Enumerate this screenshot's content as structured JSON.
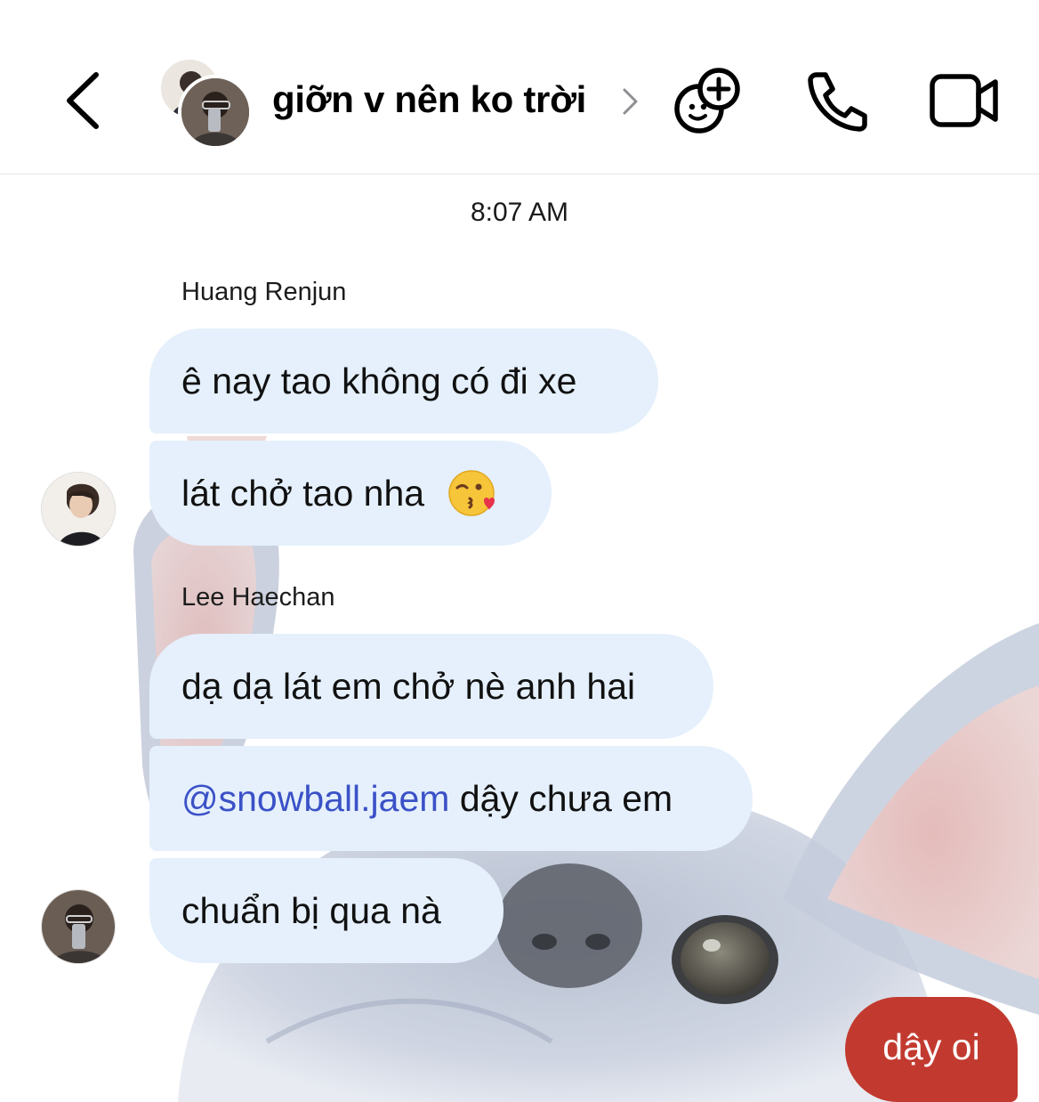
{
  "header": {
    "title": "giỡn v nên ko trời"
  },
  "timestamp": "8:07 AM",
  "messages": [
    {
      "sender": "Huang Renjun",
      "bubbles": [
        {
          "text": "ê nay tao không có đi xe"
        },
        {
          "text": "lát chở tao nha"
        }
      ]
    },
    {
      "sender": "Lee Haechan",
      "bubbles": [
        {
          "text": "dạ dạ lát em chở nè anh hai"
        },
        {
          "mention": "@snowball.jaem",
          "text": " dậy chưa em"
        },
        {
          "text": "chuẩn bị qua nà"
        }
      ]
    }
  ],
  "outgoing": {
    "text": "dậy oi",
    "color": "#c23a2f"
  },
  "colors": {
    "incoming_bubble": "#e5f0fc",
    "mention": "#3b51c7"
  },
  "icons": {
    "back": "chevron-left-icon",
    "title_chevron": "chevron-right-icon",
    "effects": "sticker-effects-icon",
    "call": "phone-icon",
    "video": "video-camera-icon",
    "emoji": "face-blowing-kiss-emoji"
  }
}
